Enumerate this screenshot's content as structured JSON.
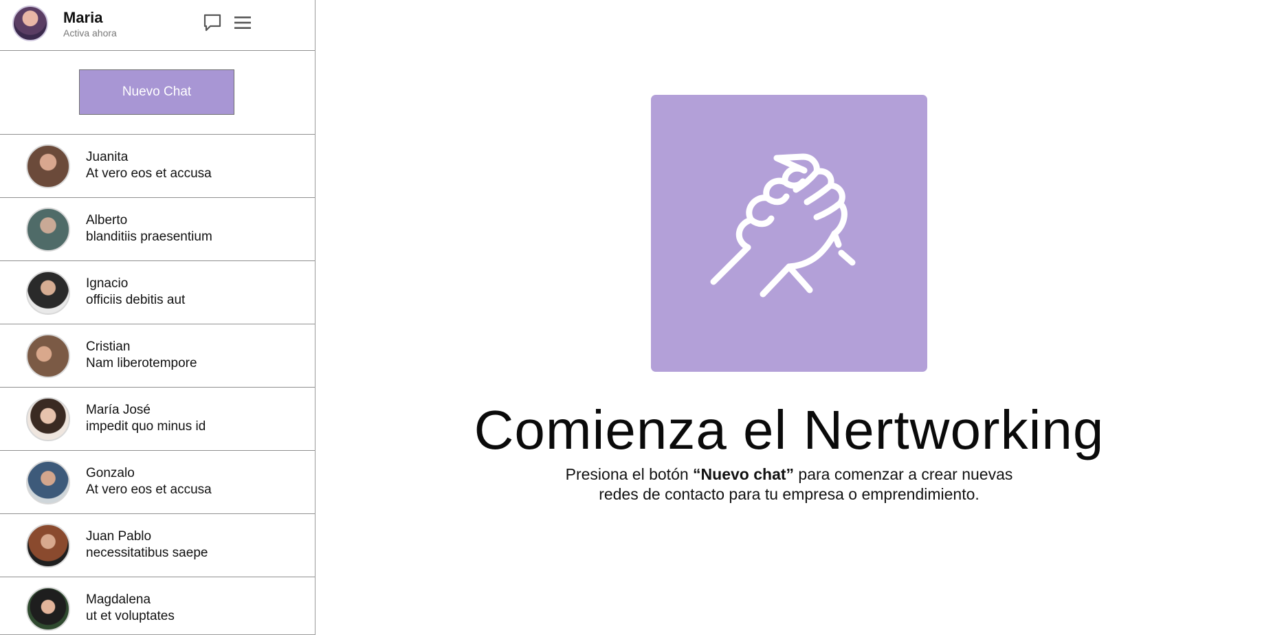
{
  "profile": {
    "name": "Maria",
    "status": "Activa ahora"
  },
  "icons": {
    "chat": "chat-bubble-icon",
    "menu": "hamburger-menu-icon",
    "hero": "handshake-icon"
  },
  "sidebar": {
    "new_chat_label": "Nuevo Chat",
    "contacts": [
      {
        "name": "Juanita",
        "preview": "At vero eos et accusa",
        "avatar_color": "#6b4a3a"
      },
      {
        "name": "Alberto",
        "preview": "blanditiis praesentium",
        "avatar_color": "#4f6b68"
      },
      {
        "name": "Ignacio",
        "preview": "officiis debitis aut",
        "avatar_color": "#2a2a2a"
      },
      {
        "name": "Cristian",
        "preview": "Nam liberotempore",
        "avatar_color": "#7b5a45"
      },
      {
        "name": "María José",
        "preview": "impedit quo minus id",
        "avatar_color": "#e8d8cc"
      },
      {
        "name": "Gonzalo",
        "preview": "At vero eos et accusa",
        "avatar_color": "#b8c2c8"
      },
      {
        "name": "Juan Pablo",
        "preview": "necessitatibus saepe",
        "avatar_color": "#1f1f1f"
      },
      {
        "name": "Magdalena",
        "preview": "ut et voluptates",
        "avatar_color": "#2f4a2f"
      }
    ]
  },
  "main": {
    "title": "Comienza el Nertworking",
    "desc_prefix": "Presiona el botón ",
    "desc_bold": "“Nuevo chat”",
    "desc_suffix": " para comenzar a crear nuevas",
    "desc_line2": "redes de contacto para tu empresa o emprendimiento."
  },
  "colors": {
    "accent": "#a896d4",
    "hero_bg": "#b3a0d8",
    "divider": "#8e8e8e"
  }
}
